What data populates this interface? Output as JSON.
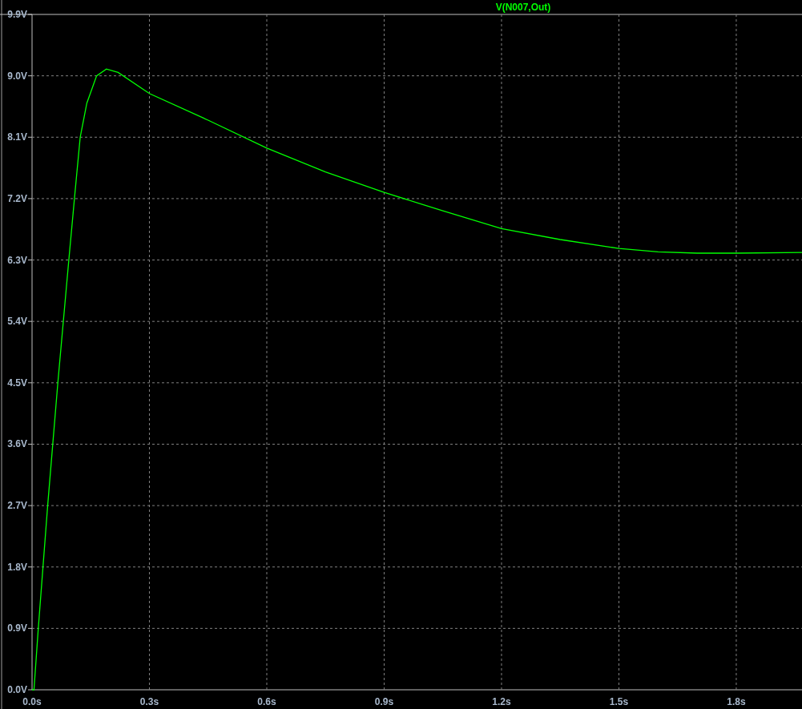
{
  "plot": {
    "chart_data": {
      "type": "line",
      "x": [
        0,
        0.005,
        0.016,
        0.04,
        0.066,
        0.094,
        0.11,
        0.123,
        0.14,
        0.165,
        0.19,
        0.22,
        0.3,
        0.45,
        0.6,
        0.75,
        0.9,
        1.05,
        1.2,
        1.35,
        1.5,
        1.6,
        1.7,
        1.8,
        1.968
      ],
      "series": [
        {
          "name": "V(N007,Out)",
          "color": "#00ff00",
          "values": [
            0,
            0,
            0.9,
            2.7,
            4.5,
            6.3,
            7.3,
            8.1,
            8.6,
            9.0,
            9.1,
            9.05,
            8.74,
            8.35,
            7.94,
            7.59,
            7.29,
            7.02,
            6.76,
            6.6,
            6.47,
            6.42,
            6.4,
            6.4,
            6.41
          ]
        }
      ],
      "grid": true,
      "xlim": [
        0,
        1.968
      ],
      "ylim": [
        0,
        9.9
      ],
      "xticks": [
        {
          "value": 0,
          "label": "0.0s"
        },
        {
          "value": 0.3,
          "label": "0.3s"
        },
        {
          "value": 0.6,
          "label": "0.6s"
        },
        {
          "value": 0.9,
          "label": "0.9s"
        },
        {
          "value": 1.2,
          "label": "1.2s"
        },
        {
          "value": 1.5,
          "label": "1.5s"
        },
        {
          "value": 1.8,
          "label": "1.8s"
        }
      ],
      "yticks": [
        {
          "value": 0,
          "label": "0.0V"
        },
        {
          "value": 0.9,
          "label": "0.9V"
        },
        {
          "value": 1.8,
          "label": "1.8V"
        },
        {
          "value": 2.7,
          "label": "2.7V"
        },
        {
          "value": 3.6,
          "label": "3.6V"
        },
        {
          "value": 4.5,
          "label": "4.5V"
        },
        {
          "value": 5.4,
          "label": "5.4V"
        },
        {
          "value": 6.3,
          "label": "6.3V"
        },
        {
          "value": 7.2,
          "label": "7.2V"
        },
        {
          "value": 8.1,
          "label": "8.1V"
        },
        {
          "value": 9.0,
          "label": "9.0V"
        },
        {
          "value": 9.9,
          "label": "9.9V"
        }
      ]
    }
  }
}
